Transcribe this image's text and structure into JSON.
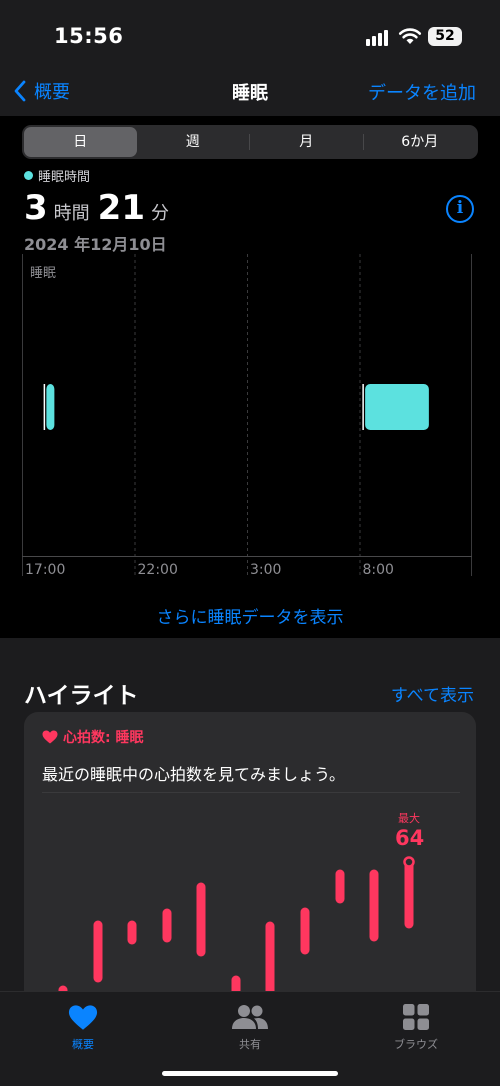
{
  "status_bar": {
    "time": "15:56",
    "battery": "52"
  },
  "nav": {
    "back_label": "概要",
    "title": "睡眠",
    "action_label": "データを追加"
  },
  "segments": [
    {
      "label": "日",
      "active": true
    },
    {
      "label": "週",
      "active": false
    },
    {
      "label": "月",
      "active": false
    },
    {
      "label": "6か月",
      "active": false
    }
  ],
  "summary": {
    "legend": "睡眠時間",
    "hours": "3",
    "hours_unit": "時間",
    "minutes": "21",
    "minutes_unit": "分",
    "date": "2024 年12月10日"
  },
  "chart_data": {
    "type": "bar",
    "title": "睡眠",
    "x_ticks": [
      "17:00",
      "22:00",
      "3:00",
      "8:00"
    ],
    "series": [
      {
        "color": "#5ce1df",
        "segments": [
          {
            "start": "18:05",
            "end": "18:20"
          },
          {
            "start": "8:15",
            "end": "11:05"
          }
        ]
      }
    ]
  },
  "more_link": "さらに睡眠データを表示",
  "highlights": {
    "title": "ハイライト",
    "show_all": "すべて表示",
    "card": {
      "category": "心拍数: 睡眠",
      "text": "最近の睡眠中の心拍数を見てみましょう。",
      "max_label": "最大",
      "max_value": "64",
      "color": "#ff375f"
    }
  },
  "tabbar": [
    {
      "label": "概要",
      "icon": "heart-icon",
      "active": true
    },
    {
      "label": "共有",
      "icon": "people-icon",
      "active": false
    },
    {
      "label": "ブラウズ",
      "icon": "grid-icon",
      "active": false
    }
  ]
}
